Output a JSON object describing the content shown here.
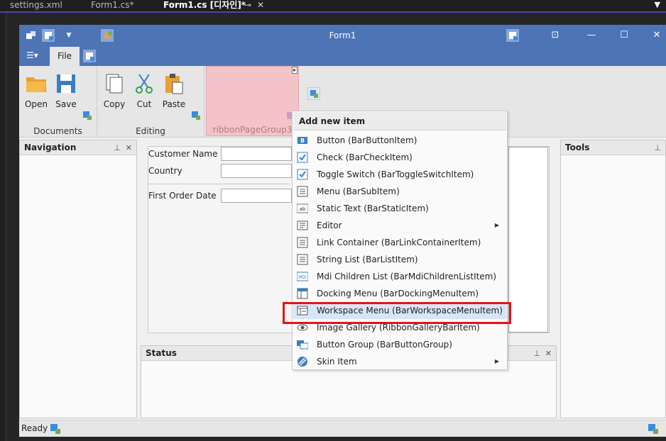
{
  "vs_tabs": [
    {
      "label": "settings.xml"
    },
    {
      "label": "Form1.cs*"
    },
    {
      "label": "Form1.cs [디자인]*"
    }
  ],
  "form": {
    "title": "Form1",
    "file_tab": "File",
    "groups": {
      "documents": "Documents",
      "editing": "Editing",
      "pink": "ribbonPageGroup3"
    },
    "buttons": {
      "open": "Open",
      "save": "Save",
      "copy": "Copy",
      "cut": "Cut",
      "paste": "Paste"
    },
    "panels": {
      "navigation": "Navigation",
      "tools": "Tools",
      "status": "Status"
    },
    "fields": {
      "customer_name": "Customer Name",
      "country": "Country",
      "first_order_date": "First Order Date"
    },
    "statusbar": "Ready"
  },
  "menu": {
    "header": "Add new item",
    "items": [
      {
        "label": "Button (BarButtonItem)",
        "icon": "button-icon"
      },
      {
        "label": "Check (BarCheckItem)",
        "icon": "check-icon"
      },
      {
        "label": "Toggle Switch (BarToggleSwitchItem)",
        "icon": "toggle-icon"
      },
      {
        "label": "Menu (BarSubItem)",
        "icon": "menu-icon"
      },
      {
        "label": "Static Text (BarStaticItem)",
        "icon": "static-text-icon",
        "glyph": "ab"
      },
      {
        "label": "Editor",
        "icon": "editor-icon",
        "submenu": true
      },
      {
        "label": "Link Container (BarLinkContainerItem)",
        "icon": "link-container-icon"
      },
      {
        "label": "String List (BarListItem)",
        "icon": "string-list-icon"
      },
      {
        "label": "Mdi Children List (BarMdiChildrenListItem)",
        "icon": "mdi-list-icon",
        "glyph": "MDI"
      },
      {
        "label": "Docking Menu (BarDockingMenuItem)",
        "icon": "docking-menu-icon"
      },
      {
        "label": "Workspace Menu (BarWorkspaceMenuItem)",
        "icon": "workspace-menu-icon",
        "highlighted": true
      },
      {
        "label": "Image Gallery (RibbonGalleryBarItem)",
        "icon": "eye-icon"
      },
      {
        "label": "Button Group (BarButtonGroup)",
        "icon": "button-group-icon"
      },
      {
        "label": "Skin Item",
        "icon": "skin-icon",
        "submenu": true
      }
    ]
  },
  "colors": {
    "titlebar": "#4d74b5",
    "accent_purple": "#5a3fa8",
    "highlight": "#d7e6f7",
    "red_box": "#e3141b",
    "pink_group": "#f3c3c8"
  }
}
